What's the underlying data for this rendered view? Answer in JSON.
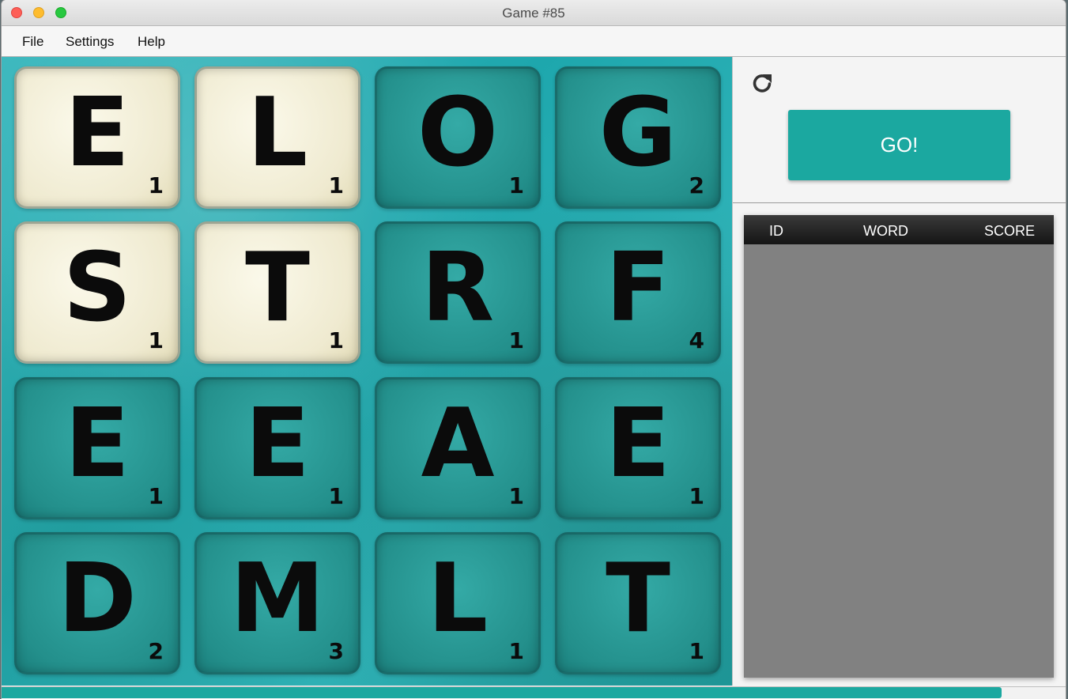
{
  "window": {
    "title": "Game #85"
  },
  "menu": {
    "items": [
      "File",
      "Settings",
      "Help"
    ]
  },
  "board": {
    "tiles": [
      {
        "letter": "E",
        "points": "1",
        "style": "light"
      },
      {
        "letter": "L",
        "points": "1",
        "style": "light"
      },
      {
        "letter": "O",
        "points": "1",
        "style": "dark"
      },
      {
        "letter": "G",
        "points": "2",
        "style": "dark"
      },
      {
        "letter": "S",
        "points": "1",
        "style": "light"
      },
      {
        "letter": "T",
        "points": "1",
        "style": "light"
      },
      {
        "letter": "R",
        "points": "1",
        "style": "dark"
      },
      {
        "letter": "F",
        "points": "4",
        "style": "dark"
      },
      {
        "letter": "E",
        "points": "1",
        "style": "dark"
      },
      {
        "letter": "E",
        "points": "1",
        "style": "dark"
      },
      {
        "letter": "A",
        "points": "1",
        "style": "dark"
      },
      {
        "letter": "E",
        "points": "1",
        "style": "dark"
      },
      {
        "letter": "D",
        "points": "2",
        "style": "dark"
      },
      {
        "letter": "M",
        "points": "3",
        "style": "dark"
      },
      {
        "letter": "L",
        "points": "1",
        "style": "dark"
      },
      {
        "letter": "T",
        "points": "1",
        "style": "dark"
      }
    ]
  },
  "controls": {
    "refresh_icon": "refresh-icon",
    "go_label": "GO!"
  },
  "results_table": {
    "columns": [
      "ID",
      "WORD",
      "SCORE"
    ],
    "rows": []
  },
  "progress": {
    "fraction": 0.94
  },
  "colors": {
    "accent": "#1ba8a0",
    "board_teal": "#2fb3b8",
    "light_tile": "#efead0"
  }
}
